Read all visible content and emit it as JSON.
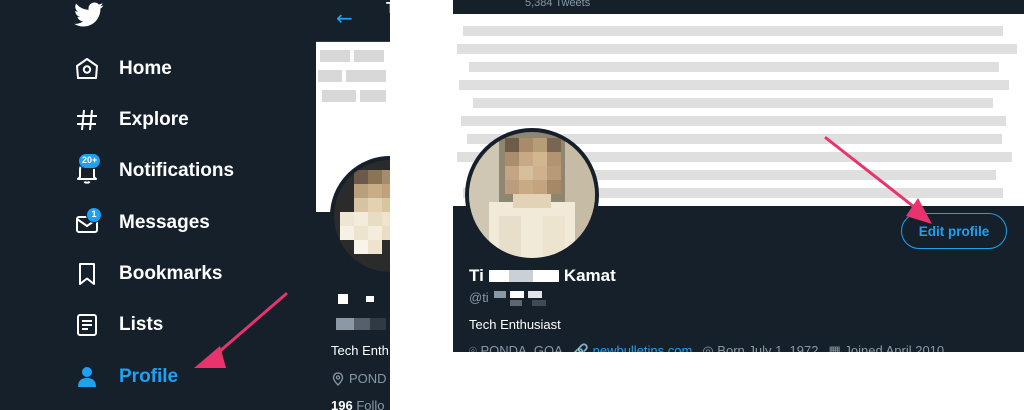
{
  "sidebar": {
    "items": [
      {
        "label": "Home",
        "icon": "home-icon"
      },
      {
        "label": "Explore",
        "icon": "hash-icon"
      },
      {
        "label": "Notifications",
        "icon": "bell-icon",
        "badge": "20+"
      },
      {
        "label": "Messages",
        "icon": "envelope-icon",
        "badge": "1"
      },
      {
        "label": "Bookmarks",
        "icon": "bookmark-icon"
      },
      {
        "label": "Lists",
        "icon": "list-icon"
      },
      {
        "label": "Profile",
        "icon": "person-icon",
        "active": true
      }
    ]
  },
  "mid_panel": {
    "back_glyph": "←",
    "title_fragment": "T",
    "bio_fragment": "Tech Enth",
    "location_fragment": "POND",
    "follow_count": "196",
    "follow_fragment": "Follo"
  },
  "profile": {
    "tweets_count": "5,384 Tweets",
    "edit_button": "Edit profile",
    "name_start": "Ti",
    "name_end": "Kamat",
    "handle_fragment": "@ti",
    "bio": "Tech Enthusiast",
    "location": "PONDA, GOA",
    "website": "newbulletins.com",
    "born": "Born July 1, 1972",
    "joined": "Joined April 2010"
  },
  "colors": {
    "background": "#15202b",
    "accent": "#1da1f2",
    "arrow": "#e8336d",
    "muted": "#8899a6"
  }
}
